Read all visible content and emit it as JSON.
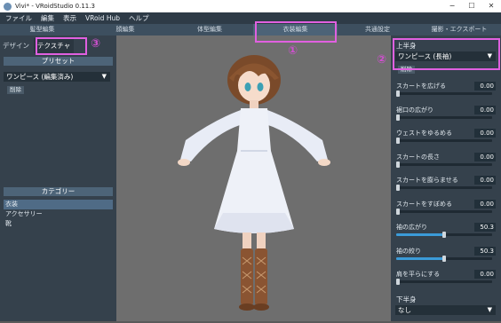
{
  "window": {
    "title": "Vivi* - VRoidStudio 0.11.3",
    "minimize": "−",
    "maximize": "☐",
    "close": "✕"
  },
  "menu": [
    "ファイル",
    "編集",
    "表示",
    "VRoid Hub",
    "ヘルプ"
  ],
  "tabs": [
    "髪型編集",
    "顔編集",
    "体型編集",
    "衣装編集",
    "共通設定",
    "撮影・エクスポート"
  ],
  "left": {
    "subtabs": [
      "デザイン",
      "テクスチャ"
    ],
    "preset_header": "プリセット",
    "preset_value": "ワンピース (編集済み)",
    "delete_label": "削除",
    "category_header": "カテゴリー",
    "categories": [
      "衣装",
      "アクセサリー",
      "靴"
    ]
  },
  "right": {
    "upper_label": "上半身",
    "upper_value": "ワンピース (長袖)",
    "delete_label": "削除",
    "sliders": [
      {
        "label": "スカートを広げる",
        "value": "0.00",
        "level": 0.0
      },
      {
        "label": "裾口の広がり",
        "value": "0.00",
        "level": 0.0
      },
      {
        "label": "ウェストをゆるめる",
        "value": "0.00",
        "level": 0.0
      },
      {
        "label": "スカートの長さ",
        "value": "0.00",
        "level": 0.0
      },
      {
        "label": "スカートを膨らませる",
        "value": "0.00",
        "level": 0.0
      },
      {
        "label": "スカートをすぼめる",
        "value": "0.00",
        "level": 0.0
      },
      {
        "label": "袖の広がり",
        "value": "50.3",
        "level": 0.503
      },
      {
        "label": "袖の絞り",
        "value": "50.3",
        "level": 0.503
      },
      {
        "label": "肩を平らにする",
        "value": "0.00",
        "level": 0.0
      }
    ],
    "lower_label": "下半身",
    "lower_value": "なし"
  },
  "annotations": [
    "①",
    "②",
    "③"
  ],
  "colors": {
    "highlight": "#e060e0",
    "accent": "#3b9bd8"
  }
}
